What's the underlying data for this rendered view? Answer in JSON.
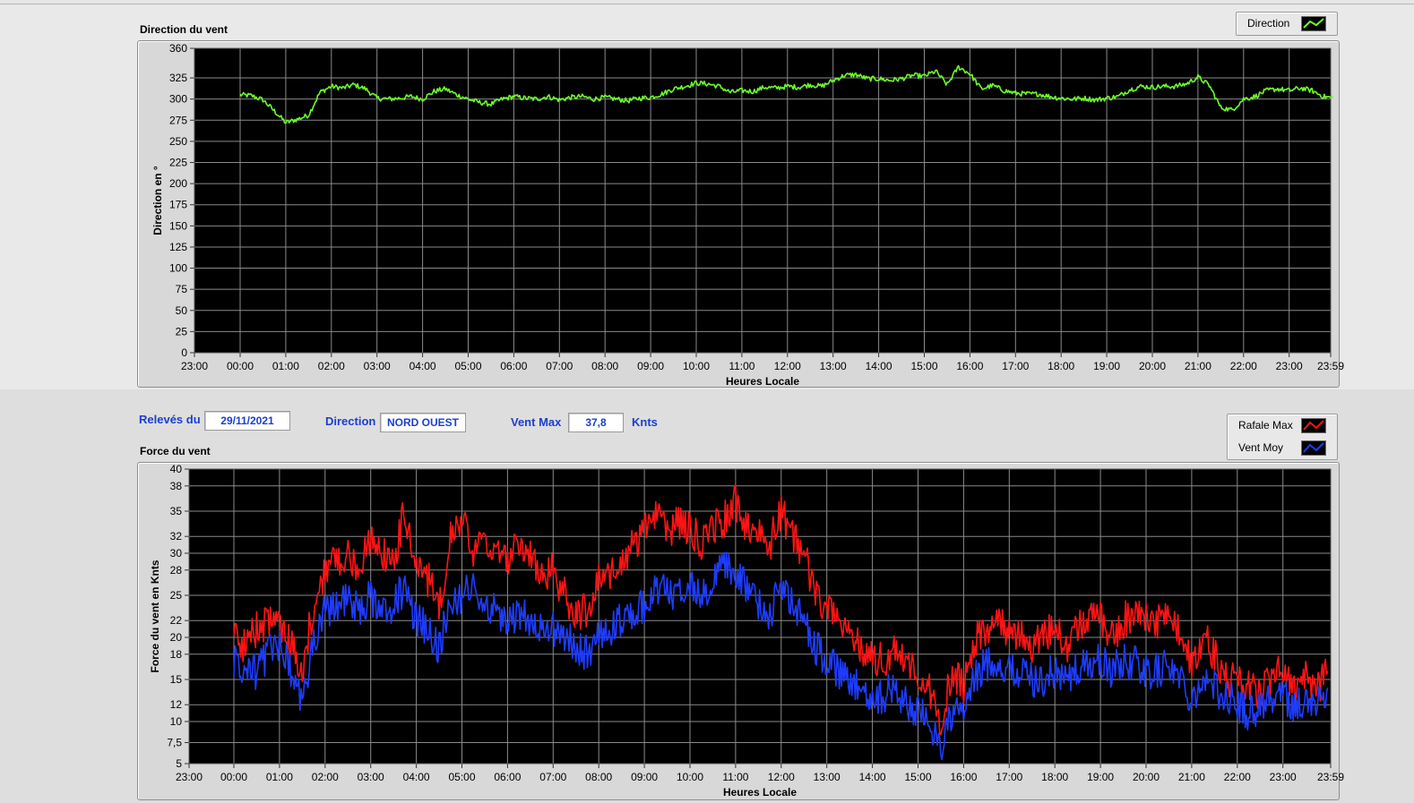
{
  "colors": {
    "plot_bg": "#000000",
    "grid": "#8a8a8a",
    "direction": "#6cff2a",
    "rafale": "#ff1414",
    "vent_moy": "#1e3cff",
    "label_blue": "#1a3fd0"
  },
  "controls": {
    "releves_label": "Relevés du",
    "releves_value": "29/11/2021",
    "direction_label": "Direction",
    "direction_value": "NORD OUEST",
    "ventmax_label": "Vent Max",
    "ventmax_value": "37,8",
    "ventmax_unit": "Knts"
  },
  "chart_data": [
    {
      "type": "line",
      "title": "Direction du vent",
      "xlabel": "Heures Locale",
      "ylabel": "Direction en °",
      "x_ticks": [
        "23:00",
        "00:00",
        "01:00",
        "02:00",
        "03:00",
        "04:00",
        "05:00",
        "06:00",
        "07:00",
        "08:00",
        "09:00",
        "10:00",
        "11:00",
        "12:00",
        "13:00",
        "14:00",
        "15:00",
        "16:00",
        "17:00",
        "18:00",
        "19:00",
        "20:00",
        "21:00",
        "22:00",
        "23:00",
        "23:59"
      ],
      "y_ticks": [
        "0",
        "25",
        "50",
        "75",
        "100",
        "125",
        "150",
        "175",
        "200",
        "225",
        "250",
        "275",
        "300",
        "325",
        "360"
      ],
      "ylim": [
        0,
        360
      ],
      "grid": true,
      "legend_position": "top-right",
      "series": [
        {
          "name": "Direction",
          "color_key": "direction",
          "x_hours": [
            0,
            0.25,
            0.5,
            0.75,
            1,
            1.25,
            1.5,
            1.75,
            2,
            2.25,
            2.5,
            2.75,
            3,
            3.25,
            3.5,
            3.75,
            4,
            4.25,
            4.5,
            4.75,
            5,
            5.25,
            5.5,
            5.75,
            6,
            6.25,
            6.5,
            6.75,
            7,
            7.25,
            7.5,
            7.75,
            8,
            8.25,
            8.5,
            8.75,
            9,
            9.25,
            9.5,
            9.75,
            10,
            10.25,
            10.5,
            10.75,
            11,
            11.25,
            11.5,
            11.75,
            12,
            12.25,
            12.5,
            12.75,
            13,
            13.25,
            13.5,
            13.75,
            14,
            14.25,
            14.5,
            14.75,
            15,
            15.25,
            15.5,
            15.75,
            16,
            16.25,
            16.5,
            16.75,
            17,
            17.25,
            17.5,
            17.75,
            18,
            18.25,
            18.5,
            18.75,
            19,
            19.25,
            19.5,
            19.75,
            20,
            20.25,
            20.5,
            20.75,
            21,
            21.25,
            21.5,
            21.75,
            22,
            22.25,
            22.5,
            22.75,
            23,
            23.25,
            23.5,
            23.75,
            23.98
          ],
          "values": [
            305,
            304,
            299,
            286,
            272,
            276,
            281,
            308,
            315,
            313,
            317,
            312,
            301,
            300,
            301,
            303,
            300,
            309,
            312,
            305,
            300,
            296,
            294,
            300,
            303,
            301,
            300,
            303,
            299,
            302,
            303,
            300,
            302,
            300,
            298,
            301,
            302,
            306,
            312,
            315,
            319,
            318,
            315,
            308,
            310,
            309,
            314,
            313,
            315,
            314,
            317,
            315,
            322,
            328,
            329,
            324,
            324,
            322,
            324,
            328,
            327,
            333,
            317,
            338,
            330,
            312,
            316,
            310,
            307,
            306,
            306,
            303,
            301,
            300,
            301,
            299,
            301,
            303,
            311,
            315,
            314,
            315,
            315,
            318,
            326,
            316,
            290,
            287,
            300,
            303,
            310,
            312,
            310,
            313,
            310,
            303,
            301
          ]
        }
      ]
    },
    {
      "type": "line",
      "title": "Force du vent",
      "xlabel": "Heures Locale",
      "ylabel": "Force du vent en Knts",
      "x_ticks": [
        "23:00",
        "00:00",
        "01:00",
        "02:00",
        "03:00",
        "04:00",
        "05:00",
        "06:00",
        "07:00",
        "08:00",
        "09:00",
        "10:00",
        "11:00",
        "12:00",
        "13:00",
        "14:00",
        "15:00",
        "16:00",
        "17:00",
        "18:00",
        "19:00",
        "20:00",
        "21:00",
        "22:00",
        "23:00",
        "23:59"
      ],
      "y_ticks": [
        "5",
        "7,5",
        "10",
        "12",
        "15",
        "18",
        "20",
        "22",
        "25",
        "28",
        "30",
        "32",
        "35",
        "38",
        "40"
      ],
      "ylim": [
        5,
        40
      ],
      "grid": true,
      "legend_position": "top-right",
      "series": [
        {
          "name": "Rafale Max",
          "color_key": "rafale",
          "x_hours": [
            0,
            0.25,
            0.5,
            0.75,
            1,
            1.25,
            1.5,
            1.75,
            2,
            2.25,
            2.5,
            2.75,
            3,
            3.25,
            3.5,
            3.75,
            4,
            4.25,
            4.5,
            4.75,
            5,
            5.25,
            5.5,
            5.75,
            6,
            6.25,
            6.5,
            6.75,
            7,
            7.25,
            7.5,
            7.75,
            8,
            8.25,
            8.5,
            8.75,
            9,
            9.25,
            9.5,
            9.75,
            10,
            10.25,
            10.5,
            10.75,
            11,
            11.25,
            11.5,
            11.75,
            12,
            12.25,
            12.5,
            12.75,
            13,
            13.25,
            13.5,
            13.75,
            14,
            14.25,
            14.5,
            14.75,
            15,
            15.25,
            15.5,
            15.75,
            16,
            16.25,
            16.5,
            16.75,
            17,
            17.25,
            17.5,
            17.75,
            18,
            18.25,
            18.5,
            18.75,
            19,
            19.25,
            19.5,
            19.75,
            20,
            20.25,
            20.5,
            20.75,
            21,
            21.25,
            21.5,
            21.75,
            22,
            22.25,
            22.5,
            22.75,
            23,
            23.25,
            23.5,
            23.75,
            23.98
          ],
          "values": [
            20,
            19,
            21,
            22,
            22,
            19,
            16,
            24,
            28,
            29,
            30,
            28,
            32,
            30,
            29,
            35,
            28,
            27,
            24,
            32,
            34,
            30,
            31,
            30,
            29,
            31,
            30,
            27,
            28,
            25,
            23,
            23,
            28,
            27,
            29,
            31,
            33,
            35,
            32,
            34,
            33,
            31,
            33,
            34,
            36,
            33,
            32,
            31,
            35,
            32,
            30,
            25,
            24,
            22,
            21,
            19,
            18,
            17,
            19,
            17,
            15,
            14,
            10,
            16,
            14,
            20,
            21,
            22,
            20,
            21,
            19,
            20,
            21,
            19,
            21,
            22,
            22,
            20,
            22,
            23,
            22,
            22,
            23,
            20,
            17,
            20,
            18,
            15,
            15,
            14,
            13,
            15,
            16,
            14,
            15,
            14,
            16
          ]
        },
        {
          "name": "Vent Moy",
          "color_key": "vent_moy",
          "x_hours": [
            0,
            0.25,
            0.5,
            0.75,
            1,
            1.25,
            1.5,
            1.75,
            2,
            2.25,
            2.5,
            2.75,
            3,
            3.25,
            3.5,
            3.75,
            4,
            4.25,
            4.5,
            4.75,
            5,
            5.25,
            5.5,
            5.75,
            6,
            6.25,
            6.5,
            6.75,
            7,
            7.25,
            7.5,
            7.75,
            8,
            8.25,
            8.5,
            8.75,
            9,
            9.25,
            9.5,
            9.75,
            10,
            10.25,
            10.5,
            10.75,
            11,
            11.25,
            11.5,
            11.75,
            12,
            12.25,
            12.5,
            12.75,
            13,
            13.25,
            13.5,
            13.75,
            14,
            14.25,
            14.5,
            14.75,
            15,
            15.25,
            15.5,
            15.75,
            16,
            16.25,
            16.5,
            16.75,
            17,
            17.25,
            17.5,
            17.75,
            18,
            18.25,
            18.5,
            18.75,
            19,
            19.25,
            19.5,
            19.75,
            20,
            20.25,
            20.5,
            20.75,
            21,
            21.25,
            21.5,
            21.75,
            22,
            22.25,
            22.5,
            22.75,
            23,
            23.25,
            23.5,
            23.75,
            23.98
          ],
          "values": [
            17,
            16,
            16,
            18,
            19,
            16,
            12,
            20,
            23,
            24,
            25,
            23,
            25,
            23,
            24,
            26,
            22,
            21,
            19,
            24,
            25,
            26,
            24,
            23,
            22,
            23,
            22,
            21,
            21,
            20,
            19,
            18,
            21,
            21,
            22,
            23,
            24,
            26,
            25,
            26,
            26,
            25,
            27,
            28,
            28,
            26,
            24,
            23,
            26,
            24,
            22,
            19,
            17,
            16,
            14,
            14,
            13,
            13,
            14,
            12,
            11,
            10,
            7,
            11,
            11,
            15,
            17,
            17,
            16,
            16,
            15,
            15,
            16,
            15,
            16,
            17,
            17,
            16,
            17,
            17,
            16,
            16,
            17,
            15,
            13,
            15,
            14,
            13,
            12,
            11,
            12,
            13,
            13,
            12,
            12,
            12,
            14
          ]
        }
      ]
    }
  ]
}
